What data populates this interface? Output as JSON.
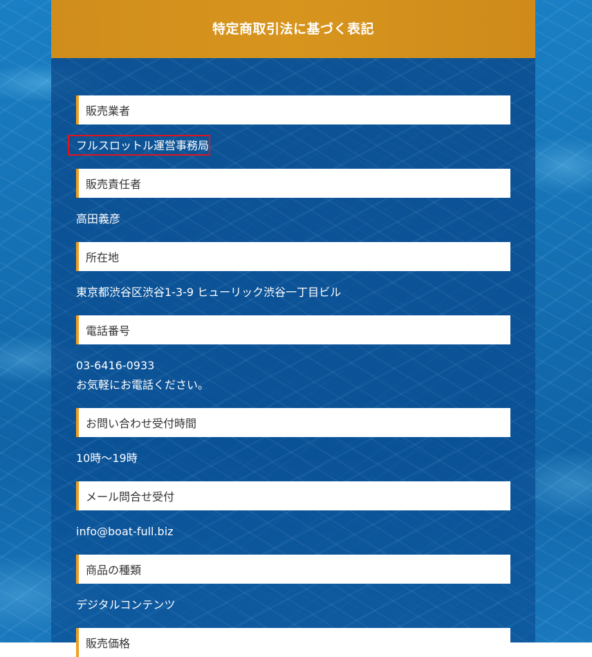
{
  "header": {
    "title": "特定商取引法に基づく表記"
  },
  "sections": [
    {
      "label": "販売業者",
      "value": "フルスロットル運営事務局"
    },
    {
      "label": "販売責任者",
      "value": "高田義彦"
    },
    {
      "label": "所在地",
      "value": "東京都渋谷区渋谷1-3-9 ヒューリック渋谷一丁目ビル"
    },
    {
      "label": "電話番号",
      "value": "03-6416-0933",
      "note": "お気軽にお電話ください。"
    },
    {
      "label": "お問い合わせ受付時間",
      "value": "10時～19時"
    },
    {
      "label": "メール問合せ受付",
      "value": "info@boat-full.biz"
    },
    {
      "label": "商品の種類",
      "value": "デジタルコンテンツ"
    },
    {
      "label": "販売価格"
    }
  ],
  "highlight": {
    "color": "#e0141e"
  },
  "colors": {
    "header_bg": "#d7951e",
    "label_accent": "#f0a020",
    "label_bg": "#ffffff",
    "panel_bg": "#0a4a8a"
  }
}
